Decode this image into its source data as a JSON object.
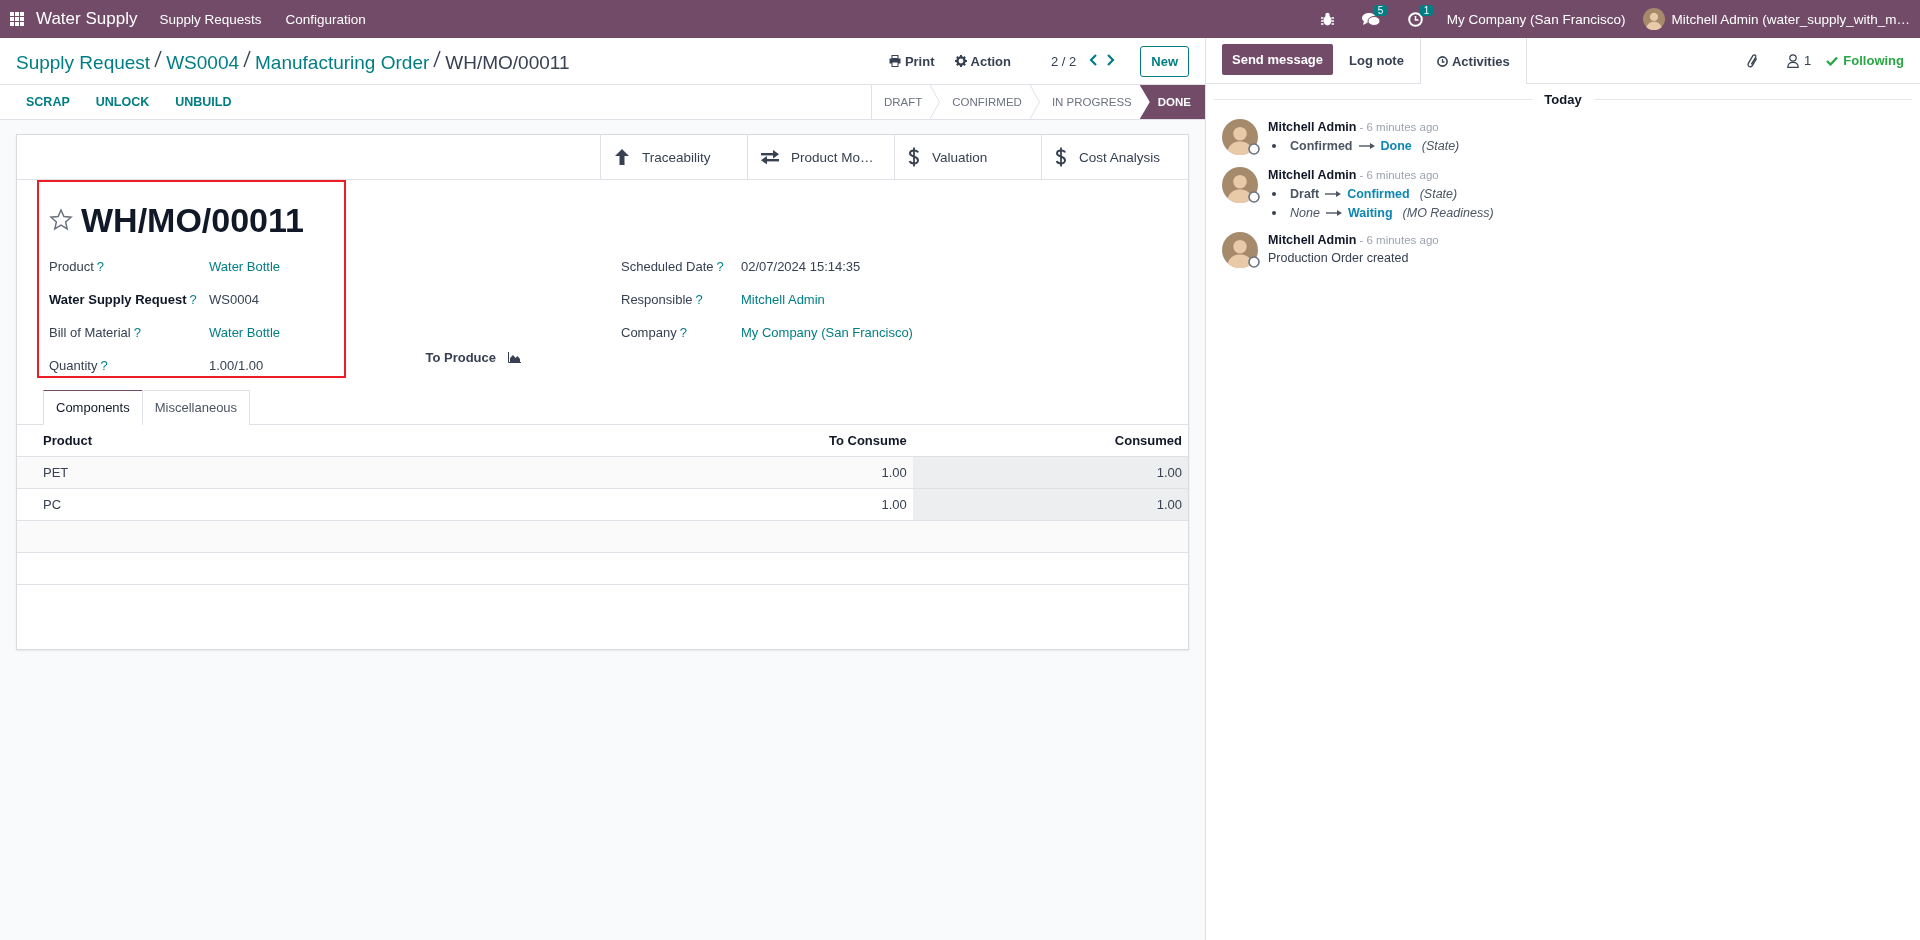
{
  "navbar": {
    "app_name": "Water Supply",
    "menu": [
      "Supply Requests",
      "Configuration"
    ],
    "messages_count": "5",
    "activities_count": "1",
    "company": "My Company (San Francisco)",
    "user": "Mitchell Admin (water_supply_with_m…"
  },
  "breadcrumbs": [
    "Supply Request",
    "WS0004",
    "Manufacturing Order"
  ],
  "breadcrumb_current": "WH/MO/00011",
  "actions": [
    {
      "label": "Print",
      "kind": "print"
    },
    {
      "label": "Action",
      "kind": "gear"
    }
  ],
  "pager": "2 / 2",
  "new_button": "New",
  "status_buttons": [
    "SCRAP",
    "UNLOCK",
    "UNBUILD"
  ],
  "stages": [
    {
      "label": "DRAFT",
      "selected": false
    },
    {
      "label": "CONFIRMED",
      "selected": false
    },
    {
      "label": "IN PROGRESS",
      "selected": false
    },
    {
      "label": "DONE",
      "selected": true
    }
  ],
  "smart_buttons": [
    {
      "label": "Traceability",
      "kind": "arrow"
    },
    {
      "label": "Product Mo…",
      "kind": "swap"
    },
    {
      "label": "Valuation",
      "kind": "dollar"
    },
    {
      "label": "Cost Analysis",
      "kind": "dollar"
    }
  ],
  "record": {
    "title": "WH/MO/00011",
    "starred": false,
    "fields_left": [
      {
        "label": "Product",
        "help": "?",
        "value": "Water Bottle",
        "kind": "link",
        "bold": false
      },
      {
        "label": "Water Supply Request",
        "help": "?",
        "value": "WS0004",
        "kind": "text",
        "bold": true
      },
      {
        "label": "Bill of Material",
        "help": "?",
        "value": "Water Bottle",
        "kind": "link",
        "bold": false
      },
      {
        "label": "Quantity",
        "help": "?",
        "value": "1.00/1.00",
        "kind": "text",
        "bold": false
      }
    ],
    "to_produce": "To Produce",
    "fields_right": [
      {
        "label": "Scheduled Date",
        "help": "?",
        "value": "02/07/2024 15:14:35",
        "kind": "text",
        "bold": false
      },
      {
        "label": "Responsible",
        "help": "?",
        "value": "Mitchell Admin",
        "kind": "link",
        "bold": false
      },
      {
        "label": "Company",
        "help": "?",
        "value": "My Company (San Francisco)",
        "kind": "link",
        "bold": false
      }
    ]
  },
  "tabs": [
    {
      "label": "Components",
      "selected": true
    },
    {
      "label": "Miscellaneous",
      "selected": false
    }
  ],
  "table": {
    "columns": [
      "Product",
      "To Consume",
      "Consumed"
    ],
    "rows": [
      {
        "product": "PET",
        "to_consume": "1.00",
        "consumed": "1.00"
      },
      {
        "product": "PC",
        "to_consume": "1.00",
        "consumed": "1.00"
      }
    ]
  },
  "chatter": {
    "buttons": [
      {
        "label": "Send message",
        "kind": "primary"
      },
      {
        "label": "Log note",
        "kind": "plain"
      },
      {
        "label": "Activities",
        "kind": "outlined"
      }
    ],
    "followers_count": "1",
    "following": "Following",
    "date_separator": "Today",
    "messages": [
      {
        "author": "Mitchell Admin",
        "time": "- 6 minutes ago",
        "changes": [
          {
            "old": "Confirmed",
            "old_empty": false,
            "new": "Done",
            "field": "(State)"
          }
        ]
      },
      {
        "author": "Mitchell Admin",
        "time": "- 6 minutes ago",
        "changes": [
          {
            "old": "Draft",
            "old_empty": false,
            "new": "Confirmed",
            "field": "(State)"
          },
          {
            "old": "None",
            "old_empty": true,
            "new": "Waiting",
            "field": "(MO Readiness)"
          }
        ]
      },
      {
        "author": "Mitchell Admin",
        "time": "- 6 minutes ago",
        "body": "Production Order created"
      }
    ]
  }
}
